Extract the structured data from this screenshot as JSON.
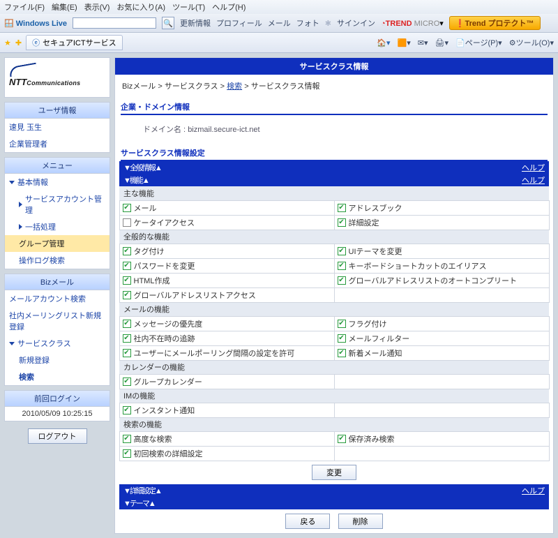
{
  "menubar": {
    "file": "ファイル(F)",
    "edit": "編集(E)",
    "view": "表示(V)",
    "fav": "お気に入り(A)",
    "tool": "ツール(T)",
    "help": "ヘルプ(H)"
  },
  "toolbar": {
    "wlive": "Windows Live",
    "news": "更新情報",
    "profile": "プロフィール",
    "mail": "メール",
    "photo": "フォト",
    "signin": "サインイン",
    "trend_a": "TREND",
    "trend_b": "MICRO",
    "protect": "Trend プロテクト™"
  },
  "tab": "セキュアICTサービス",
  "rtools": {
    "page": "ページ(P)",
    "tools": "ツール(O)"
  },
  "brand": {
    "main": "NTT",
    "sub": "Communications"
  },
  "side": {
    "user_head": "ユーザ情報",
    "user1": "速見 玉生",
    "user2": "企業管理者",
    "menu_head": "メニュー",
    "basic": "基本情報",
    "svc_acct": "サービスアカウント管理",
    "batch": "一括処理",
    "group": "グループ管理",
    "oplog": "操作ログ検索",
    "biz_head": "Bizメール",
    "mail_acct": "メールアカウント検索",
    "ml_reg": "社内メーリングリスト新規登録",
    "svc_class": "サービスクラス",
    "new_reg": "新規登録",
    "search": "検索",
    "login_head": "前回ログイン",
    "login_ts": "2010/05/09 10:25:15",
    "logout": "ログアウト"
  },
  "main": {
    "title": "サービスクラス情報",
    "bc1": "Bizメール",
    "bc2": "サービスクラス",
    "bc3": "検索",
    "bc4": "サービスクラス情報",
    "sec_domain": "企業・ドメイン情報",
    "domain_label": "ドメイン名 :",
    "domain_value": "bizmail.secure-ict.net",
    "sec_settings": "サービスクラス情報設定",
    "band_all": "▼全般情報▲",
    "band_feat": "▼機能▲",
    "help": "ヘルプ",
    "cat_main": "主な機能",
    "cat_global": "全般的な機能",
    "cat_mail": "メールの機能",
    "cat_cal": "カレンダーの機能",
    "cat_im": "IMの機能",
    "cat_search": "検索の機能",
    "f": {
      "mail": "メール",
      "address": "アドレスブック",
      "keitai": "ケータイアクセス",
      "detail": "詳細設定",
      "tag": "タグ付け",
      "uitheme": "UIテーマを変更",
      "pwchange": "パスワードを変更",
      "kb_alias": "キーボードショートカットのエイリアス",
      "htmlcomp": "HTML作成",
      "gal_auto": "グローバルアドレスリストのオートコンプリート",
      "gal_access": "グローバルアドレスリストアクセス",
      "priority": "メッセージの優先度",
      "flag": "フラグ付け",
      "oof": "社内不在時の追跡",
      "mfilter": "メールフィルター",
      "poll": "ユーザーにメールポーリング間隔の設定を許可",
      "newmail": "新着メール通知",
      "gcal": "グループカレンダー",
      "instant": "インスタント通知",
      "advsearch": "高度な検索",
      "saved": "保存済み検索",
      "initdetail": "初回検索の詳細設定"
    },
    "btn_change": "変更",
    "band_detail": "▼詳細設定▲",
    "band_theme": "▼テーマ▲",
    "btn_back": "戻る",
    "btn_delete": "削除"
  }
}
